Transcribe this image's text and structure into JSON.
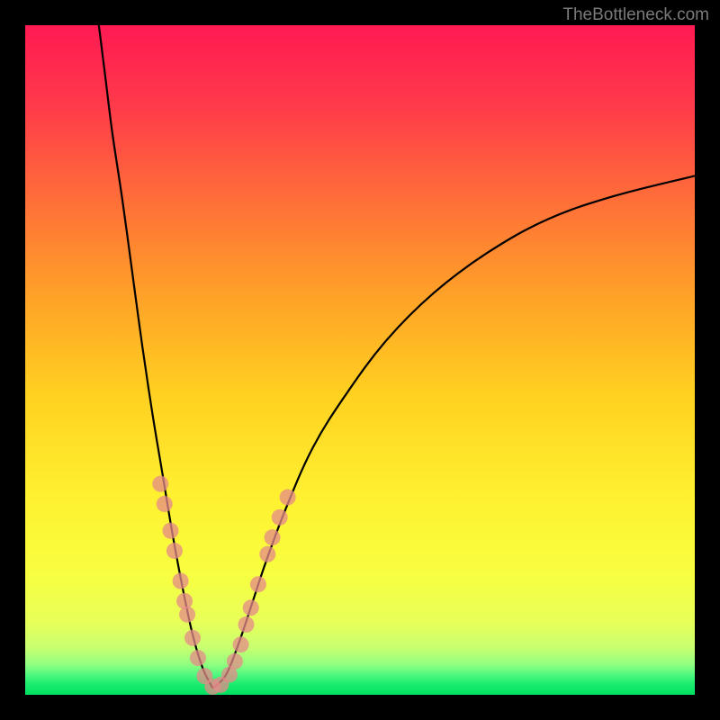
{
  "watermark": "TheBottleneck.com",
  "chart_data": {
    "type": "line",
    "title": "",
    "xlabel": "",
    "ylabel": "",
    "ylim": [
      0,
      100
    ],
    "xlim": [
      0,
      100
    ],
    "gradient": {
      "top_color": "#ff1a52",
      "mid_colors": [
        "#ff5a3a",
        "#ffb020",
        "#ffe030",
        "#f7ff40",
        "#d8ff60"
      ],
      "bottom_color": "#00e060",
      "bottom_band_start_pct": 92
    },
    "curve": {
      "description": "V-shaped bottleneck curve with minimum near x≈28 at y≈0, rising steeply left (to y≈100 at x≈11) and more gently right (to y≈77 at x≈100). Points are (x%, y%) in plot-area coordinates with y=0 at bottom.",
      "left_branch": [
        {
          "x": 11.0,
          "y": 100.0
        },
        {
          "x": 12.0,
          "y": 92.0
        },
        {
          "x": 13.0,
          "y": 84.0
        },
        {
          "x": 14.5,
          "y": 74.0
        },
        {
          "x": 16.0,
          "y": 63.0
        },
        {
          "x": 17.5,
          "y": 52.0
        },
        {
          "x": 19.0,
          "y": 42.0
        },
        {
          "x": 20.5,
          "y": 33.0
        },
        {
          "x": 22.0,
          "y": 24.0
        },
        {
          "x": 23.5,
          "y": 16.0
        },
        {
          "x": 25.0,
          "y": 9.0
        },
        {
          "x": 26.5,
          "y": 4.0
        },
        {
          "x": 28.0,
          "y": 1.0
        }
      ],
      "right_branch": [
        {
          "x": 28.0,
          "y": 1.0
        },
        {
          "x": 30.0,
          "y": 3.0
        },
        {
          "x": 32.0,
          "y": 8.0
        },
        {
          "x": 34.0,
          "y": 14.0
        },
        {
          "x": 36.0,
          "y": 20.0
        },
        {
          "x": 39.0,
          "y": 28.0
        },
        {
          "x": 43.0,
          "y": 37.0
        },
        {
          "x": 48.0,
          "y": 45.0
        },
        {
          "x": 54.0,
          "y": 53.0
        },
        {
          "x": 61.0,
          "y": 60.0
        },
        {
          "x": 69.0,
          "y": 66.0
        },
        {
          "x": 78.0,
          "y": 71.0
        },
        {
          "x": 88.0,
          "y": 74.5
        },
        {
          "x": 100.0,
          "y": 77.5
        }
      ]
    },
    "markers": {
      "description": "Pink circular markers overlaid on lower portion of V-curve (bottleneck zone). Radius in px.",
      "radius": 9,
      "points": [
        {
          "x": 20.2,
          "y": 31.5
        },
        {
          "x": 20.8,
          "y": 28.5
        },
        {
          "x": 21.7,
          "y": 24.5
        },
        {
          "x": 22.3,
          "y": 21.5
        },
        {
          "x": 23.2,
          "y": 17.0
        },
        {
          "x": 23.8,
          "y": 14.0
        },
        {
          "x": 24.2,
          "y": 12.0
        },
        {
          "x": 25.0,
          "y": 8.5
        },
        {
          "x": 25.8,
          "y": 5.5
        },
        {
          "x": 26.8,
          "y": 2.8
        },
        {
          "x": 28.0,
          "y": 1.2
        },
        {
          "x": 29.2,
          "y": 1.5
        },
        {
          "x": 30.5,
          "y": 3.0
        },
        {
          "x": 31.3,
          "y": 5.0
        },
        {
          "x": 32.2,
          "y": 7.5
        },
        {
          "x": 33.0,
          "y": 10.5
        },
        {
          "x": 33.7,
          "y": 13.0
        },
        {
          "x": 34.8,
          "y": 16.5
        },
        {
          "x": 36.2,
          "y": 21.0
        },
        {
          "x": 36.9,
          "y": 23.5
        },
        {
          "x": 38.0,
          "y": 26.5
        },
        {
          "x": 39.2,
          "y": 29.5
        }
      ]
    }
  }
}
